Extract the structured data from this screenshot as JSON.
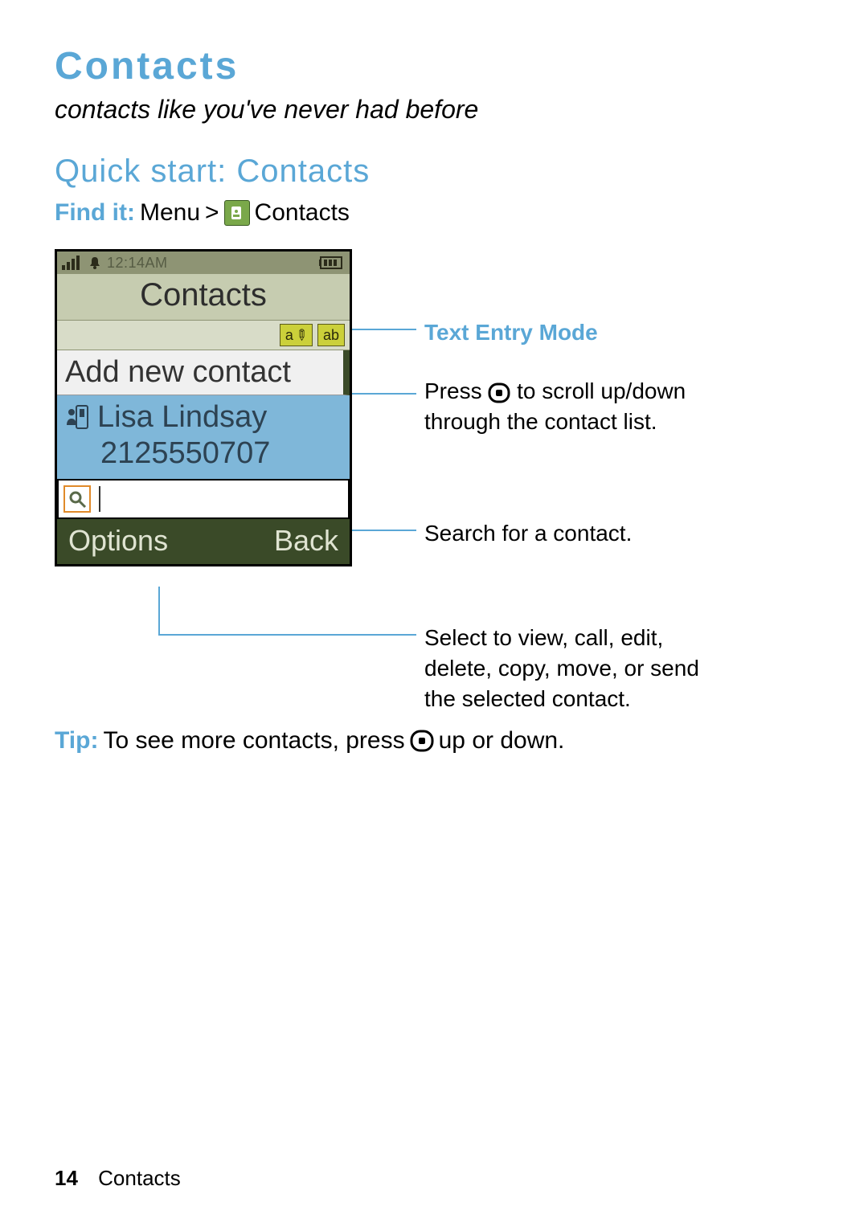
{
  "heading": "Contacts",
  "tagline": "contacts like you've never had before",
  "section": "Quick start: Contacts",
  "find_it": {
    "label": "Find it:",
    "menu": "Menu",
    "sep": ">",
    "target": "Contacts"
  },
  "phone": {
    "time": "12:14AM",
    "title": "Contacts",
    "entry_mode": {
      "chip1": "a",
      "chip2": "ab"
    },
    "add_new": "Add new contact",
    "contact": {
      "name": "Lisa Lindsay",
      "number": "2125550707"
    },
    "softkeys": {
      "left": "Options",
      "right": "Back"
    }
  },
  "callouts": {
    "text_entry": "Text Entry Mode",
    "scroll_a": "Press",
    "scroll_b": "to scroll up/down",
    "scroll_c": "through the contact list.",
    "search": "Search for a contact.",
    "options_a": "Select to view, call, edit,",
    "options_b": "delete, copy, move, or send",
    "options_c": "the selected contact."
  },
  "tip": {
    "label": "Tip:",
    "a": "To see more contacts, press",
    "b": "up or down."
  },
  "footer": {
    "page": "14",
    "section": "Contacts"
  }
}
